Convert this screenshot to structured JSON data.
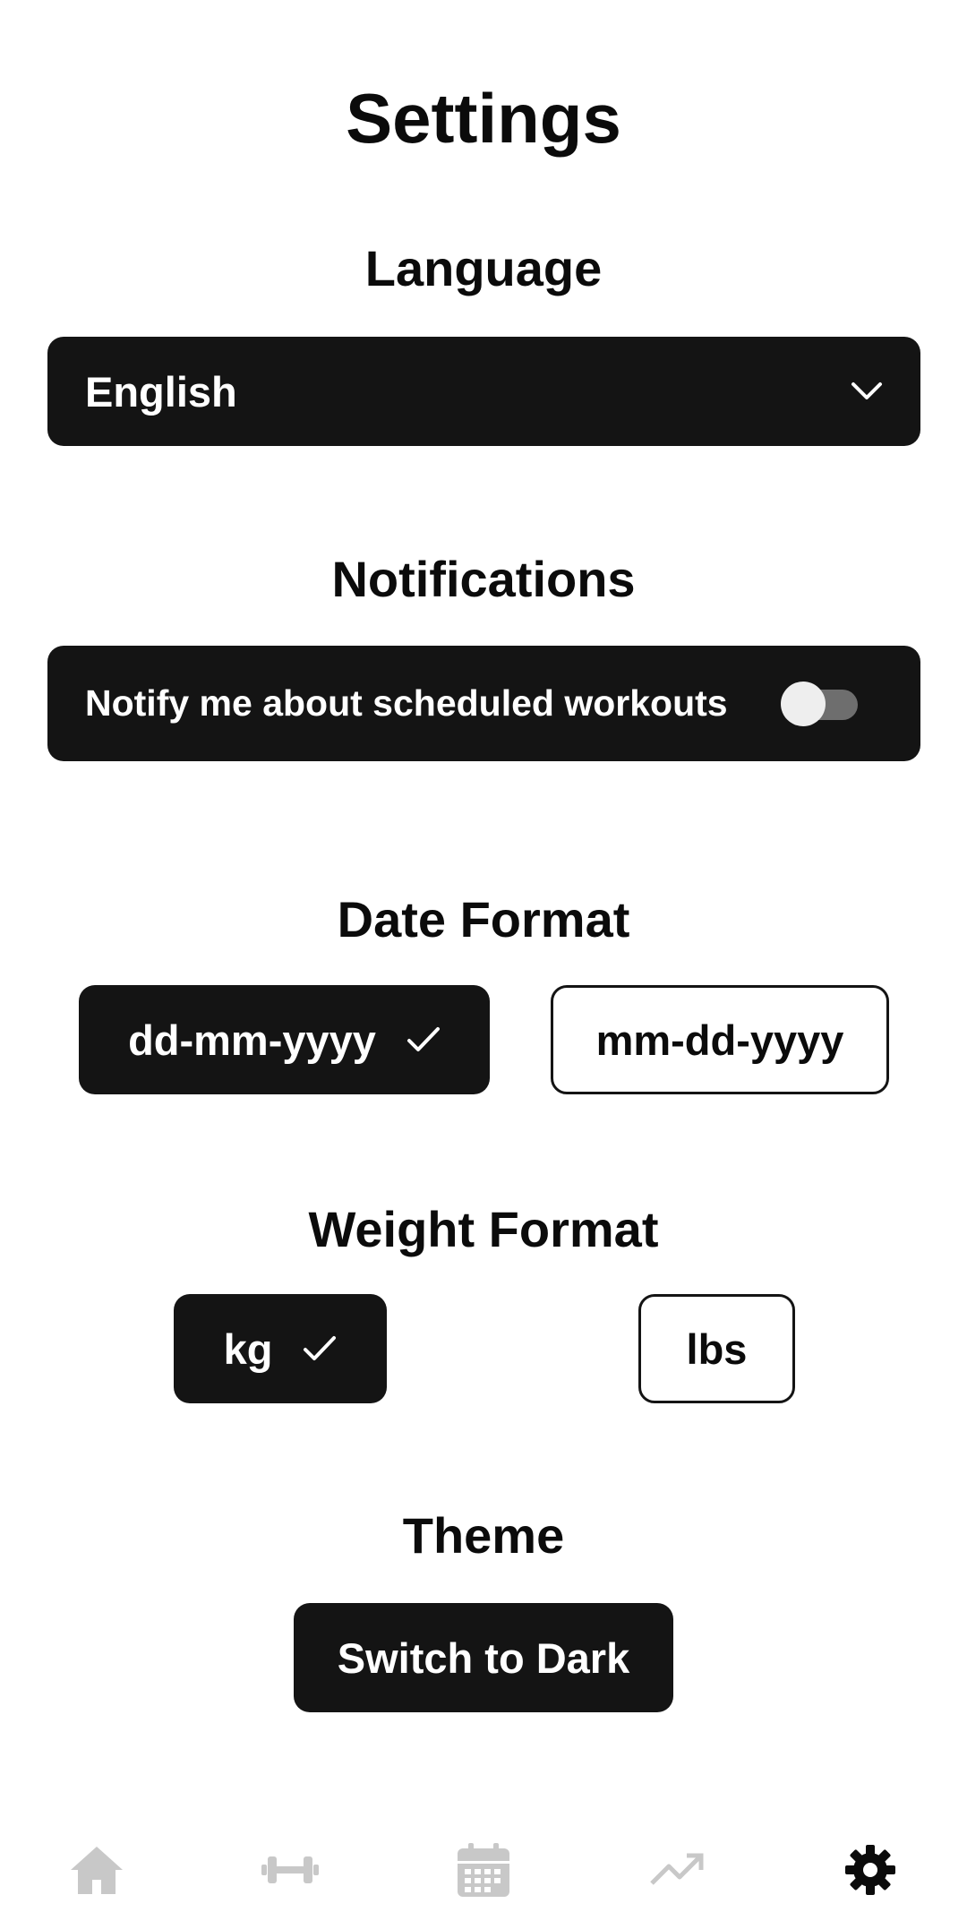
{
  "header": {
    "title": "Settings"
  },
  "language": {
    "title": "Language",
    "selected": "English",
    "icon": "chevron-down-icon"
  },
  "notifications": {
    "title": "Notifications",
    "label": "Notify me about scheduled workouts",
    "enabled": false
  },
  "date_format": {
    "title": "Date Format",
    "options": [
      {
        "label": "dd-mm-yyyy",
        "selected": true
      },
      {
        "label": "mm-dd-yyyy",
        "selected": false
      }
    ]
  },
  "weight_format": {
    "title": "Weight Format",
    "options": [
      {
        "label": "kg",
        "selected": true
      },
      {
        "label": "lbs",
        "selected": false
      }
    ]
  },
  "theme": {
    "title": "Theme",
    "button_label": "Switch to Dark"
  },
  "tabbar": {
    "items": [
      {
        "icon": "home-icon",
        "active": false
      },
      {
        "icon": "dumbbell-icon",
        "active": false
      },
      {
        "icon": "calendar-icon",
        "active": false
      },
      {
        "icon": "trending-up-icon",
        "active": false
      },
      {
        "icon": "gear-icon",
        "active": true
      }
    ]
  },
  "colors": {
    "primary": "#141414",
    "background": "#ffffff",
    "inactive_icon": "#c8c8c8",
    "toggle_track": "#6e6e6e",
    "toggle_thumb": "#eeeeee"
  }
}
